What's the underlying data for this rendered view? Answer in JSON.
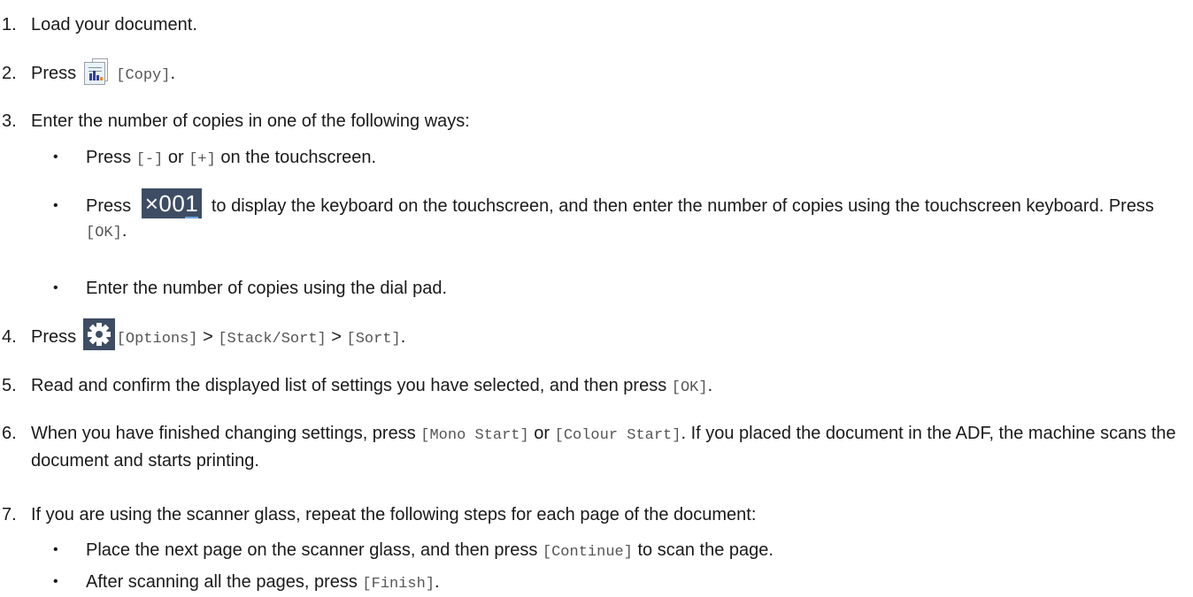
{
  "steps": [
    {
      "num": "1.",
      "text": "Load your document."
    },
    {
      "num": "2.",
      "pre": "Press",
      "icon": "copy-icon",
      "code": "[Copy]",
      "post": "."
    },
    {
      "num": "3.",
      "text": "Enter the number of copies in one of the following ways:"
    },
    {
      "num": "4.",
      "pre": "Press",
      "icon": "gear-icon",
      "code1": "[Options]",
      "sep1": " > ",
      "code2": "[Stack/Sort]",
      "sep2": " > ",
      "code3": "[Sort]",
      "post": "."
    },
    {
      "num": "5.",
      "pre": "Read and confirm the displayed list of settings you have selected, and then press",
      "code": "[OK]",
      "post": "."
    },
    {
      "num": "6.",
      "pre": "When you have finished changing settings, press",
      "code1": "[Mono Start]",
      "mid": "or",
      "code2": "[Colour Start]",
      "post": ". If you placed the document in the ADF, the machine scans the document and starts printing."
    },
    {
      "num": "7.",
      "text": "If you are using the scanner glass, repeat the following steps for each page of the document:"
    }
  ],
  "step3_bullets": [
    {
      "pre": "Press",
      "code1": "[-]",
      "mid": "or",
      "code2": "[+]",
      "post": "on the touchscreen."
    },
    {
      "pre": "Press",
      "badge_prefix": "×",
      "badge_digits": "00",
      "badge_last": "1",
      "post": "to display the keyboard on the touchscreen, and then enter the number of copies using the touchscreen keyboard. Press",
      "code": "[OK]",
      "end": "."
    },
    {
      "text": "Enter the number of copies using the dial pad."
    }
  ],
  "step7_bullets": [
    {
      "pre": "Place the next page on the scanner glass, and then press",
      "code": "[Continue]",
      "post": "to scan the page."
    },
    {
      "pre": "After scanning all the pages, press",
      "code": "[Finish]",
      "post": "."
    }
  ],
  "bullet_char": "•",
  "colors": {
    "text": "#1a1a1a",
    "code": "#555555",
    "icon_bg": "#3e4d63",
    "badge_underline": "#6aa8e8"
  }
}
